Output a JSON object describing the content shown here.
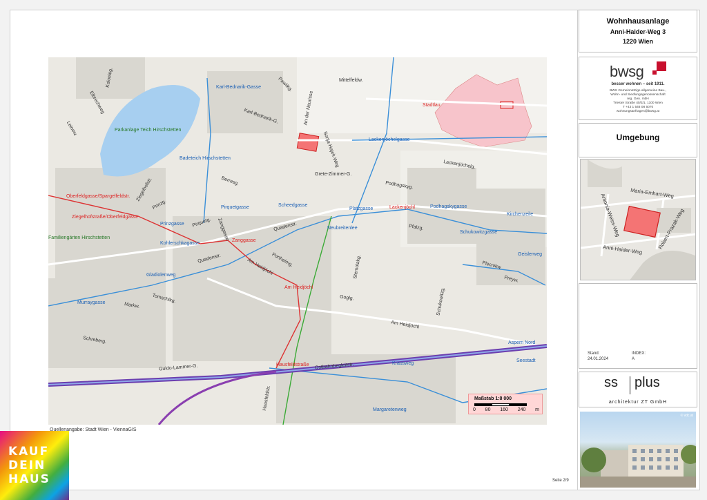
{
  "title_block": {
    "line1": "Wohnhausanlage",
    "line2": "Anni-Haider-Weg 3",
    "line3": "1220 Wien"
  },
  "developer": {
    "name": "bwsg",
    "tagline": "besser wohnen – seit 1911.",
    "details": [
      "BWS Gemeinnützige allgemeine Bau-,",
      "Wohn- und Siedlungsgenossenschaft",
      "reg. Gen. mbH",
      "Triester Straße 40/3/1, 1100 Wien",
      "T +43 1 546 08 5070",
      "wohnungsanfragen@bwsg.at"
    ]
  },
  "section_heading": "Umgebung",
  "stand": {
    "label": "Stand:",
    "value": "24.01.2024",
    "index_label": "INDEX:",
    "index_value": "A"
  },
  "architect": {
    "name_left": "ss",
    "name_right": "plus",
    "sub": "architektur ZT GmbH"
  },
  "render_copyright": "© vdc.at",
  "source_note": "Quellenangabe: Stadt Wien - ViennaGIS",
  "page": "Seite   2/9",
  "scale": {
    "title": "Maßstab 1:8 000",
    "ticks": [
      "0",
      "80",
      "160",
      "240",
      "m"
    ]
  },
  "badge_lines": [
    "KAUF",
    "DEIN",
    "HAUS"
  ],
  "map_labels": [
    {
      "text": "Mittelfeldw.",
      "cls": ""
    },
    {
      "text": "Karl-Bednarik-Gasse",
      "cls": "blue"
    },
    {
      "text": "Pawlikg.",
      "cls": ""
    },
    {
      "text": "Karl-Bednarik-G.",
      "cls": ""
    },
    {
      "text": "An der Neurisse",
      "cls": ""
    },
    {
      "text": "Parkanlage Teich Hirschstetten",
      "cls": "green"
    },
    {
      "text": "Badeteich Hirschstetten",
      "cls": "blue"
    },
    {
      "text": "Lackenjöchelgasse",
      "cls": "blue"
    },
    {
      "text": "Sonja-Hajek-Weg",
      "cls": ""
    },
    {
      "text": "Grete-Zimmer-G.",
      "cls": ""
    },
    {
      "text": "Lackenjöchelg.",
      "cls": ""
    },
    {
      "text": "Podhagskyg.",
      "cls": ""
    },
    {
      "text": "Lackenjöchl",
      "cls": "red"
    },
    {
      "text": "Podhagskygasse",
      "cls": "blue"
    },
    {
      "text": "Platzgasse",
      "cls": "blue"
    },
    {
      "text": "Pfalzg.",
      "cls": ""
    },
    {
      "text": "Oberfeldgasse/Spargelfeldstr.",
      "cls": "red"
    },
    {
      "text": "Ziegelhofstraße/Oberfeldgasse",
      "cls": "red"
    },
    {
      "text": "Prinzgasse",
      "cls": "blue"
    },
    {
      "text": "Pirquetgasse",
      "cls": "blue"
    },
    {
      "text": "Scheedgasse",
      "cls": "blue"
    },
    {
      "text": "Quadenstr.",
      "cls": ""
    },
    {
      "text": "Neubreitenlee",
      "cls": "blue"
    },
    {
      "text": "Berresg.",
      "cls": ""
    },
    {
      "text": "Prinzg.",
      "cls": ""
    },
    {
      "text": "Zanggasse",
      "cls": "red"
    },
    {
      "text": "Kohlerschkagasse",
      "cls": "blue"
    },
    {
      "text": "Quadenstr.",
      "cls": ""
    },
    {
      "text": "Am Heidjöchl",
      "cls": ""
    },
    {
      "text": "Am Heidjöchl",
      "cls": "red"
    },
    {
      "text": "Portheimg.",
      "cls": ""
    },
    {
      "text": "Stemolakg.",
      "cls": ""
    },
    {
      "text": "Goglg.",
      "cls": ""
    },
    {
      "text": "Schukowitzg.",
      "cls": ""
    },
    {
      "text": "Am Heidjöchl",
      "cls": ""
    },
    {
      "text": "Aspern Nord",
      "cls": "blue"
    },
    {
      "text": "Seestadt",
      "cls": "blue"
    },
    {
      "text": "Hausfeldstr.",
      "cls": ""
    },
    {
      "text": "Ostbahnbegleitstr.",
      "cls": ""
    },
    {
      "text": "Guido-Lammer-G.",
      "cls": ""
    },
    {
      "text": "Schreberg.",
      "cls": ""
    },
    {
      "text": "Tomschikg.",
      "cls": ""
    },
    {
      "text": "Markw.",
      "cls": ""
    },
    {
      "text": "Murraygasse",
      "cls": "blue"
    },
    {
      "text": "Gladiolenweg",
      "cls": "blue"
    },
    {
      "text": "Plecnikw.",
      "cls": ""
    },
    {
      "text": "Preyw.",
      "cls": ""
    },
    {
      "text": "Kirchenzeile",
      "cls": "blue"
    },
    {
      "text": "Schukowitzgasse",
      "cls": "blue"
    },
    {
      "text": "Geislerweg",
      "cls": "blue"
    },
    {
      "text": "Margaretenweg",
      "cls": "blue"
    },
    {
      "text": "Krausweg",
      "cls": "blue"
    },
    {
      "text": "Hausfeldstraße",
      "cls": "red"
    },
    {
      "text": "Familiengärten Hirschstetten",
      "cls": "green"
    },
    {
      "text": "Kolonieg.",
      "cls": ""
    },
    {
      "text": "Elbrechweg",
      "cls": ""
    },
    {
      "text": "Leinew.",
      "cls": ""
    },
    {
      "text": "Ziegelhofstr.",
      "cls": ""
    },
    {
      "text": "Pirquetg.",
      "cls": ""
    },
    {
      "text": "Zanggasse",
      "cls": ""
    },
    {
      "text": "Stadtlau",
      "cls": "red"
    }
  ],
  "inset_labels": [
    "Maria-Emhart-Weg",
    "Antonia-Weiss-Weg",
    "Robert-Prazak-Weg",
    "Anni-Haider-Weg"
  ],
  "colors": {
    "plot_fill": "#f47474",
    "plot_stroke": "#c22",
    "road_blue": "#3a8fd8",
    "rail_purple": "#6b3fb0",
    "district_pink": "#f7c4cb"
  }
}
